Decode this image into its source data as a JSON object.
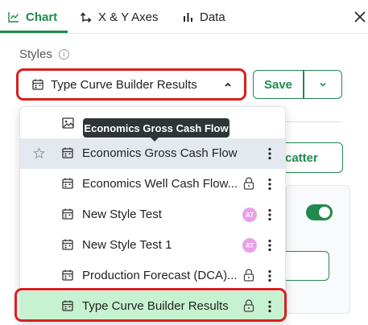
{
  "tabs": [
    {
      "label": "Chart",
      "icon": "line-chart-icon",
      "active": true
    },
    {
      "label": "X & Y Axes",
      "icon": "axes-arrows-icon",
      "active": false
    },
    {
      "label": "Data",
      "icon": "bar-chart-icon",
      "active": false
    }
  ],
  "styles": {
    "label": "Styles",
    "selected": "Type Curve Builder Results",
    "save_label": "Save"
  },
  "tooltip": "Economics Gross Cash Flow",
  "dropdown": {
    "items": [
      {
        "label": "",
        "icon": "image-icon"
      },
      {
        "label": "Economics Gross Cash Flow",
        "icon": "calendar-icon"
      },
      {
        "label": "Economics Well Cash Flow...",
        "icon": "calendar-icon",
        "locked": true
      },
      {
        "label": "New Style Test",
        "icon": "calendar-icon",
        "avatar": "AT"
      },
      {
        "label": "New Style Test 1",
        "icon": "calendar-icon",
        "avatar": "AT"
      },
      {
        "label": "Production Forecast (DCA)...",
        "icon": "calendar-icon",
        "locked": true
      },
      {
        "label": "Type Curve Builder Results",
        "icon": "calendar-icon",
        "locked": true,
        "selected": true
      }
    ]
  },
  "background": {
    "scatter_label": "catter"
  },
  "colors": {
    "accent": "#1f8a4c",
    "highlight_outline": "#d91f1f",
    "selected_row": "#c7f2cf",
    "hover_row": "#e4e9f0",
    "avatar": "#e7a1e8"
  }
}
